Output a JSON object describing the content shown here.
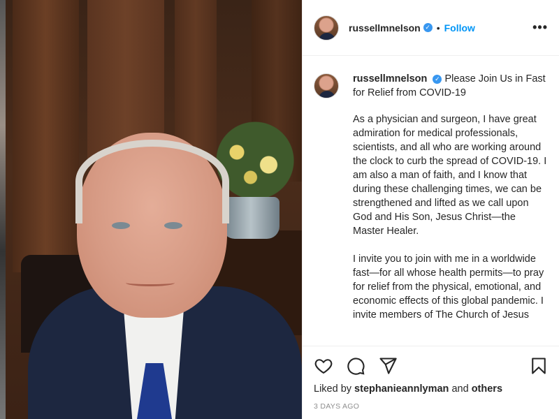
{
  "post": {
    "username": "russellmnelson",
    "verified_mark": "✓",
    "separator": "•",
    "follow_label": "Follow",
    "more_icon": "•••"
  },
  "caption": {
    "username": "russellmnelson",
    "title": "Please Join Us in Fast for Relief from COVID-19",
    "paragraph1": "As a physician and surgeon, I have great admiration for medical professionals, scientists, and all who are working around the clock to curb the spread of COVID-19. I am also a man of faith, and I know that during these challenging times, we can be strengthened and lifted as we call upon God and His Son, Jesus Christ—the Master Healer.",
    "paragraph2": "I invite you to join with me in a worldwide fast—for all whose health permits—to pray for relief from the physical, emotional, and economic effects of this global pandemic. I invite members of The Church of Jesus"
  },
  "actions": {
    "liked_by_prefix": "Liked by",
    "liked_by_user": "stephanieannlyman",
    "liked_by_and": "and",
    "liked_by_others": "others",
    "timestamp": "3 DAYS AGO"
  },
  "icons": {
    "heart": "heart-icon",
    "comment": "comment-icon",
    "share": "share-icon",
    "save": "bookmark-icon"
  },
  "colors": {
    "link_blue": "#0095f6",
    "verified_blue": "#3897f0",
    "text": "#262626",
    "muted": "#8e8e8e"
  }
}
